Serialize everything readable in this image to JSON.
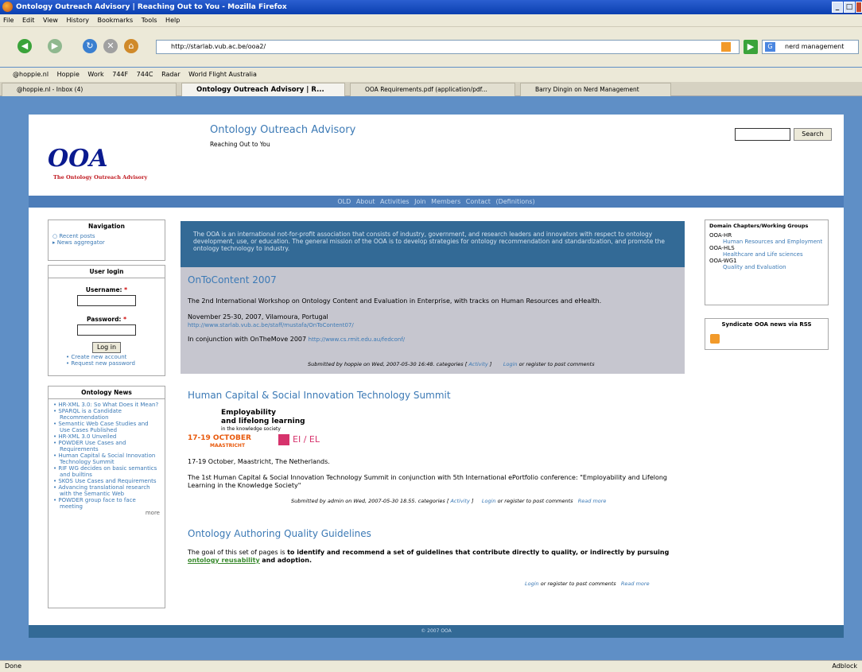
{
  "window": {
    "title": "Ontology Outreach Advisory | Reaching Out to You - Mozilla Firefox"
  },
  "menu": [
    "File",
    "Edit",
    "View",
    "History",
    "Bookmarks",
    "Tools",
    "Help"
  ],
  "address": {
    "url": "http://starlab.vub.ac.be/ooa2/"
  },
  "search": {
    "value": "nerd management"
  },
  "bookmarks": [
    "@hoppie.nl",
    "Hoppie",
    "Work",
    "744F",
    "744C",
    "Radar",
    "World Flight Australia"
  ],
  "tabs": [
    {
      "label": "@hoppie.nl - Inbox (4)"
    },
    {
      "label": "Ontology Outreach Advisory | R..."
    },
    {
      "label": "OOA Requirements.pdf (application/pdf..."
    },
    {
      "label": "Barry Dingin on Nerd Management"
    }
  ],
  "site": {
    "logo": "OOA",
    "logo_sub": "The Ontology Outreach Advisory",
    "name": "Ontology Outreach Advisory",
    "slogan": "Reaching Out to You",
    "search_button": "Search"
  },
  "primary_nav": [
    "OLD",
    "About",
    "Activities",
    "Join",
    "Members",
    "Contact",
    "(Definitions)"
  ],
  "navigation": {
    "title": "Navigation",
    "items": [
      "Recent posts",
      "News aggregator"
    ]
  },
  "login": {
    "title": "User login",
    "username_label": "Username:",
    "password_label": "Password:",
    "required_mark": "*",
    "button": "Log in",
    "links": [
      "Create new account",
      "Request new password"
    ]
  },
  "ontology_news": {
    "title": "Ontology News",
    "items": [
      "HR-XML 3.0: So What Does it Mean?",
      "SPARQL is a Candidate Recommendation",
      "Semantic Web Case Studies and Use Cases Published",
      "HR-XML 3.0 Unveiled",
      "POWDER Use Cases and Requirements",
      "Human Capital & Social Innovation Technology Summit",
      "RIF WG decides on basic semantics and builtins",
      "SKOS Use Cases and Requirements",
      "Advancing translational research with the Semantic Web",
      "POWDER group face to face meeting"
    ],
    "more": "more"
  },
  "mission": "The OOA is an international not-for-profit association that consists of industry, government, and research leaders and innovators with respect to ontology development, use, or education. The general mission of the OOA is to develop strategies for ontology recommendation and standardization, and promote the ontology technology to industry.",
  "post1": {
    "title": "OnToContent 2007",
    "body": "The 2nd International Workshop on Ontology Content and Evaluation in Enterprise, with tracks on Human Resources and eHealth.",
    "date": "November 25-30, 2007, Vilamoura, Portugal",
    "url": "http://www.starlab.vub.ac.be/staff/mustafa/OnToContent07/",
    "conj_text": "In conjunction with OnTheMove 2007",
    "conj_url": "http://www.cs.rmit.edu.au/fedconf/",
    "submitted": "Submitted by hoppie on Wed, 2007-05-30 16:48. categories [",
    "category": "Activity",
    "close": "]",
    "login": "Login",
    "or_register": "or register to post comments"
  },
  "post2": {
    "title": "Human Capital & Social Innovation Technology Summit",
    "banner_line1": "Employability",
    "banner_line2": "and lifelong learning",
    "banner_line3": "in the knowledge society",
    "banner_dates": "17-19 OCTOBER",
    "banner_city": "MAASTRICHT",
    "banner_mark": "EI / EL",
    "location": "17-19 October, Maastricht, The Netherlands.",
    "body": "The 1st Human Capital & Social Innovation Technology Summit in conjunction with 5th International ePortfolio conference: \"Employability and Lifelong Learning in the Knowledge Society\"",
    "submitted": "Submitted by admin on Wed, 2007-05-30 18.55. categories [",
    "category": "Activity",
    "close": "]",
    "login": "Login",
    "or_register": "or register to post comments",
    "read_more": "Read more"
  },
  "post3": {
    "title": "Ontology Authoring Quality Guidelines",
    "body_prefix": "The goal of this set of pages is",
    "body_bold": "to identify and recommend a set of guidelines that contribute directly to quality, or indirectly by pursuing",
    "link": "ontology reusability",
    "body_suffix": "and adoption.",
    "login": "Login",
    "or_register": "or register to post comments",
    "read_more": "Read more"
  },
  "domain_chapters": {
    "title": "Domain Chapters/Working Groups",
    "items": [
      {
        "code": "OOA-HR",
        "name": "Human Resources and Employment"
      },
      {
        "code": "OOA-HLS",
        "name": "Healthcare and Life sciences"
      },
      {
        "code": "OOA-WG1",
        "name": "Quality and Evaluation"
      }
    ]
  },
  "syndicate": {
    "title": "Syndicate OOA news via RSS"
  },
  "footer": "© 2007 OOA",
  "status": {
    "left": "Done",
    "right": "Adblock"
  },
  "colors": {
    "banner": "#4d7db9",
    "mission_bg": "#336a96",
    "post_bg": "#c6c6cf",
    "link": "#3b79b5"
  }
}
